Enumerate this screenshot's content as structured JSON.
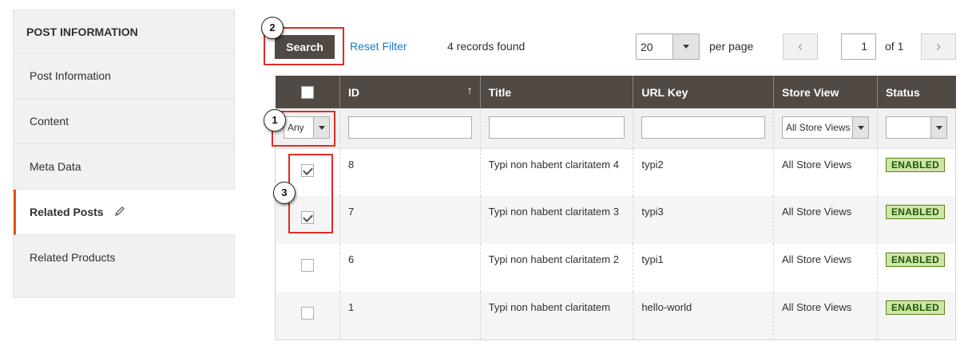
{
  "sidebar": {
    "title": "POST INFORMATION",
    "items": [
      {
        "label": "Post Information"
      },
      {
        "label": "Content"
      },
      {
        "label": "Meta Data"
      },
      {
        "label": "Related Posts",
        "icon": "pencil-icon"
      },
      {
        "label": "Related Products"
      }
    ]
  },
  "toolbar": {
    "search_label": "Search",
    "reset_label": "Reset Filter",
    "records_text": "4 records found",
    "per_page_value": "20",
    "per_page_label": "per page",
    "current_page": "1",
    "of_text": "of 1",
    "prev_icon": "chevron-left-icon",
    "next_icon": "chevron-right-icon"
  },
  "grid": {
    "columns": [
      "ID",
      "Title",
      "URL Key",
      "Store View",
      "Status"
    ],
    "filters": {
      "checkbox_filter": "Any",
      "store_view_filter": "All Store Views",
      "status_filter": ""
    },
    "rows": [
      {
        "checked": true,
        "id": "8",
        "title": "Typi non habent claritatem 4",
        "url_key": "typi2",
        "store_view": "All Store Views",
        "status": "ENABLED"
      },
      {
        "checked": true,
        "id": "7",
        "title": "Typi non habent claritatem 3",
        "url_key": "typi3",
        "store_view": "All Store Views",
        "status": "ENABLED"
      },
      {
        "checked": false,
        "id": "6",
        "title": "Typi non habent claritatem 2",
        "url_key": "typi1",
        "store_view": "All Store Views",
        "status": "ENABLED"
      },
      {
        "checked": false,
        "id": "1",
        "title": "Typi non habent claritatem",
        "url_key": "hello-world",
        "store_view": "All Store Views",
        "status": "ENABLED"
      }
    ]
  },
  "annotations": [
    "1",
    "2",
    "3"
  ],
  "colors": {
    "header_bg": "#514943",
    "accent": "#eb5202",
    "link": "#1979c3",
    "callout": "#e02b27",
    "badge_bg": "#d0e5a9"
  }
}
